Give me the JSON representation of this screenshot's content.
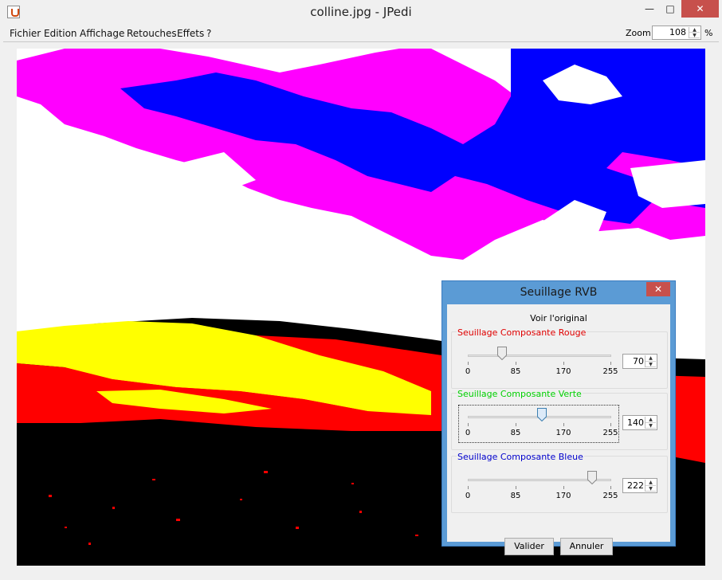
{
  "window": {
    "title": "colline.jpg  -  JPedi",
    "min_glyph": "—",
    "max_glyph": "□",
    "close_glyph": "✕"
  },
  "menu": [
    "Fichier",
    "Edition",
    "Affichage",
    "Retouches",
    "Effets",
    "?"
  ],
  "zoom": {
    "label": "Zoom:",
    "value": "108",
    "unit": "%"
  },
  "image_colors": {
    "white": "#ffffff",
    "magenta": "#ff00ff",
    "blue": "#0000ff",
    "yellow": "#ffff00",
    "red": "#ff0000",
    "black": "#000000"
  },
  "dialog": {
    "title": "Seuillage RVB",
    "close_glyph": "✕",
    "voir_original": "Voir l'original",
    "ticks": [
      "0",
      "85",
      "170",
      "255"
    ],
    "sliders": [
      {
        "title": "Seuillage Composante Rouge",
        "color": "#e00000",
        "value": "70"
      },
      {
        "title": "Seuillage Composante Verte",
        "color": "#00d000",
        "value": "140"
      },
      {
        "title": "Seuillage Composante Bleue",
        "color": "#0000cc",
        "value": "222"
      }
    ],
    "ok_label": "Valider",
    "cancel_label": "Annuler"
  }
}
